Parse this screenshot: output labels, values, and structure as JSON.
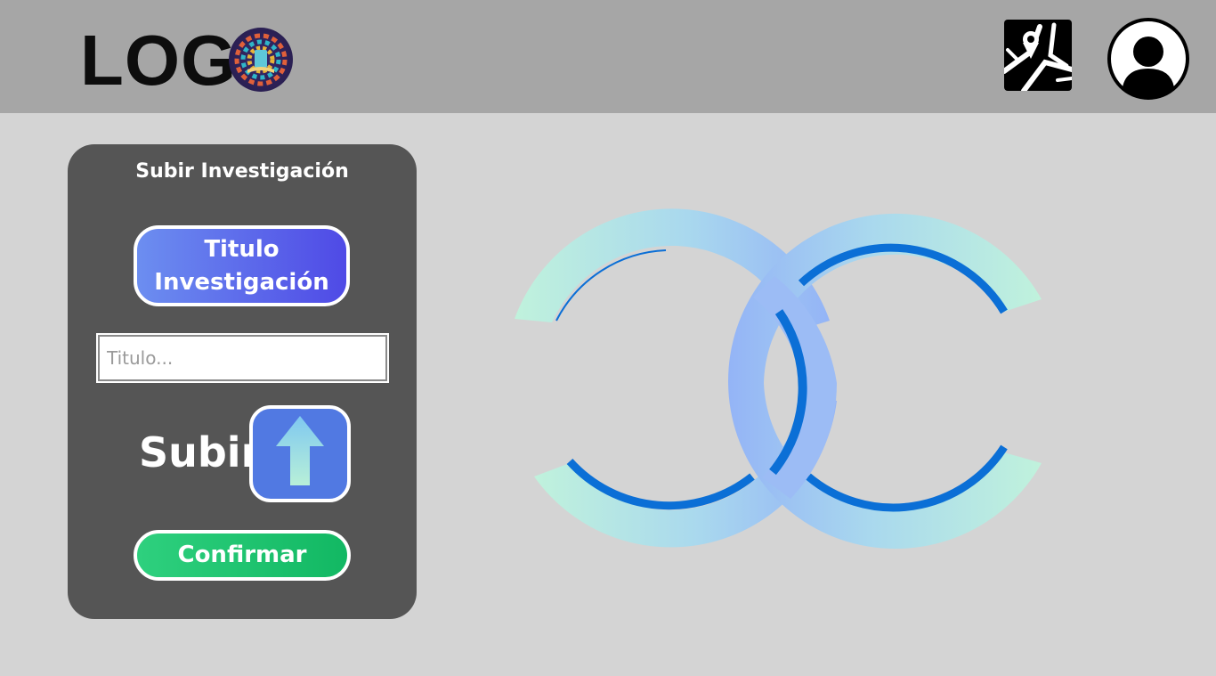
{
  "header": {
    "logo_text": "LOG",
    "icons": {
      "logo_badge": "book-emblem-icon",
      "map": "map-icon",
      "profile": "user-avatar-icon"
    },
    "background": "#a6a6a6"
  },
  "upload_panel": {
    "title": "Subir Investigación",
    "title_button_label": "Titulo Investigación",
    "title_input": {
      "value": "",
      "placeholder": "Titulo..."
    },
    "upload_label": "Subir",
    "upload_icon": "arrow-up-icon",
    "confirm_label": "Confirmar"
  },
  "colors": {
    "panel": "#555555",
    "title_button": "#5a6ae8",
    "upload_button": "#5179e2",
    "confirm_button": "#1fc470",
    "page_background": "#d4d4d4"
  },
  "decoration": {
    "icon": "interlocking-c-rings-emblem"
  }
}
